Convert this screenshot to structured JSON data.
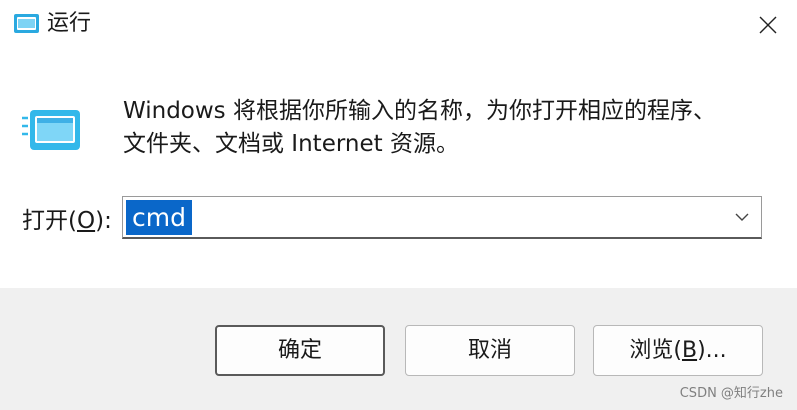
{
  "window": {
    "title": "运行",
    "close_icon": "close-icon"
  },
  "dialog": {
    "description_line1": "Windows 将根据你所输入的名称，为你打开相应的程序、",
    "description_line2": "文件夹、文档或 Internet 资源。",
    "open_label_prefix": "打开(",
    "open_label_accel": "O",
    "open_label_suffix": "):",
    "input_value": "cmd",
    "input_selected": true
  },
  "buttons": {
    "ok": "确定",
    "cancel": "取消",
    "browse_prefix": "浏览(",
    "browse_accel": "B",
    "browse_suffix": ")..."
  },
  "watermark": "CSDN @知行zhe",
  "colors": {
    "selection": "#0a67c9",
    "footer_bg": "#f0f0f0",
    "icon_blue": "#33b8ea"
  }
}
